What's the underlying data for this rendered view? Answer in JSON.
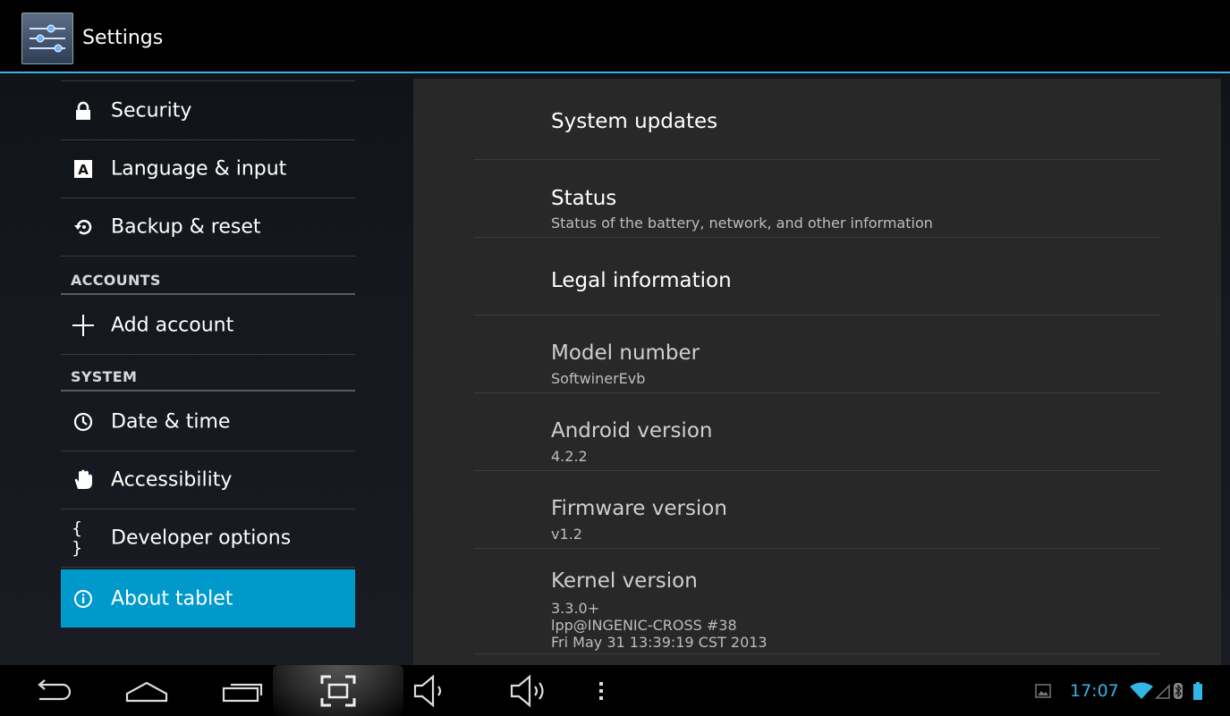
{
  "action_bar": {
    "title": "Settings",
    "icon": "settings-sliders-icon"
  },
  "sidebar": {
    "items": [
      {
        "label": "Security",
        "icon": "lock-icon"
      },
      {
        "label": "Language & input",
        "icon": "keyboard-a-icon"
      },
      {
        "label": "Backup & reset",
        "icon": "backup-reset-icon"
      },
      {
        "section": "ACCOUNTS"
      },
      {
        "label": "Add account",
        "icon": "plus-icon"
      },
      {
        "section": "SYSTEM"
      },
      {
        "label": "Date & time",
        "icon": "clock-icon"
      },
      {
        "label": "Accessibility",
        "icon": "hand-icon"
      },
      {
        "label": "Developer options",
        "icon": "braces-icon",
        "glyph": "{ }"
      },
      {
        "label": "About tablet",
        "icon": "info-icon",
        "selected": true
      }
    ]
  },
  "about": {
    "rows": [
      {
        "title": "System updates"
      },
      {
        "title": "Status",
        "summary": "Status of the battery, network, and other information"
      },
      {
        "title": "Legal information"
      },
      {
        "title": "Model number",
        "summary": "SoftwinerEvb"
      },
      {
        "title": "Android version",
        "summary": "4.2.2"
      },
      {
        "title": "Firmware version",
        "summary": "v1.2"
      },
      {
        "title": "Kernel version",
        "summary_lines": [
          "3.3.0+",
          "lpp@INGENIC-CROSS #38",
          "Fri May 31 13:39:19 CST 2013"
        ]
      }
    ]
  },
  "navbar": {
    "buttons": [
      "back-icon",
      "home-icon",
      "recent-apps-icon",
      "screenshot-icon",
      "volume-down-icon",
      "volume-up-icon",
      "menu-icon"
    ]
  },
  "status_bar": {
    "time": "17:07",
    "icons": [
      "gallery-notification-icon",
      "wifi-icon",
      "signal-icon",
      "bluetooth-icon",
      "battery-icon"
    ]
  },
  "colors": {
    "accent": "#33b5e5",
    "selected_bg": "#0099cc",
    "panel_bg": "#282828"
  }
}
